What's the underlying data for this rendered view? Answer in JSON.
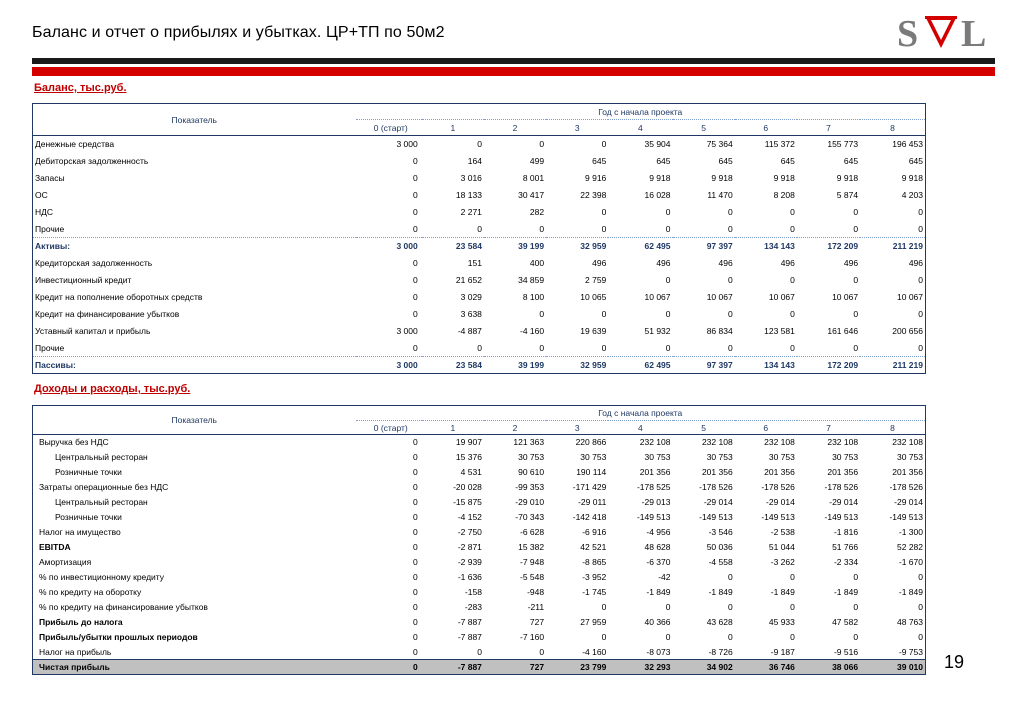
{
  "title": "Баланс и отчет о прибылях и убытках. ЦР+ТП по 50м2",
  "logo_text": "SVL",
  "colors": {
    "accent_red": "#d40000",
    "header_blue": "#1f3864",
    "total_gray": "#c0c0c0"
  },
  "balance": {
    "section_title": "Баланс, тыс.руб.",
    "indicator_header": "Показатель",
    "year_header": "Год с начала проекта",
    "columns": [
      "0 (старт)",
      "1",
      "2",
      "3",
      "4",
      "5",
      "6",
      "7",
      "8"
    ],
    "rows": [
      {
        "label": "Денежные средства",
        "values": [
          "3 000",
          "0",
          "0",
          "0",
          "35 904",
          "75 364",
          "115 372",
          "155 773",
          "196 453"
        ]
      },
      {
        "label": "Дебиторская задолженность",
        "values": [
          "0",
          "164",
          "499",
          "645",
          "645",
          "645",
          "645",
          "645",
          "645"
        ]
      },
      {
        "label": "Запасы",
        "values": [
          "0",
          "3 016",
          "8 001",
          "9 916",
          "9 918",
          "9 918",
          "9 918",
          "9 918",
          "9 918"
        ]
      },
      {
        "label": "ОС",
        "values": [
          "0",
          "18 133",
          "30 417",
          "22 398",
          "16 028",
          "11 470",
          "8 208",
          "5 874",
          "4 203"
        ]
      },
      {
        "label": "НДС",
        "values": [
          "0",
          "2 271",
          "282",
          "0",
          "0",
          "0",
          "0",
          "0",
          "0"
        ]
      },
      {
        "label": "Прочие",
        "values": [
          "0",
          "0",
          "0",
          "0",
          "0",
          "0",
          "0",
          "0",
          "0"
        ]
      },
      {
        "label": "Активы:",
        "values": [
          "3 000",
          "23 584",
          "39 199",
          "32 959",
          "62 495",
          "97 397",
          "134 143",
          "172 209",
          "211 219"
        ]
      },
      {
        "label": "Кредиторская задолженность",
        "values": [
          "0",
          "151",
          "400",
          "496",
          "496",
          "496",
          "496",
          "496",
          "496"
        ]
      },
      {
        "label": "Инвестиционный кредит",
        "values": [
          "0",
          "21 652",
          "34 859",
          "2 759",
          "0",
          "0",
          "0",
          "0",
          "0"
        ]
      },
      {
        "label": "Кредит на пополнение оборотных средств",
        "values": [
          "0",
          "3 029",
          "8 100",
          "10 065",
          "10 067",
          "10 067",
          "10 067",
          "10 067",
          "10 067"
        ]
      },
      {
        "label": "Кредит на финансирование убытков",
        "values": [
          "0",
          "3 638",
          "0",
          "0",
          "0",
          "0",
          "0",
          "0",
          "0"
        ]
      },
      {
        "label": "Уставный капитал и прибыль",
        "values": [
          "3 000",
          "-4 887",
          "-4 160",
          "19 639",
          "51 932",
          "86 834",
          "123 581",
          "161 646",
          "200 656"
        ]
      },
      {
        "label": "Прочие",
        "values": [
          "0",
          "0",
          "0",
          "0",
          "0",
          "0",
          "0",
          "0",
          "0"
        ]
      },
      {
        "label": "Пассивы:",
        "values": [
          "3 000",
          "23 584",
          "39 199",
          "32 959",
          "62 495",
          "97 397",
          "134 143",
          "172 209",
          "211 219"
        ]
      }
    ]
  },
  "pnl": {
    "section_title": "Доходы и расходы, тыс.руб.",
    "indicator_header": "Показатель",
    "year_header": "Год с начала проекта",
    "columns": [
      "0 (старт)",
      "1",
      "2",
      "3",
      "4",
      "5",
      "6",
      "7",
      "8"
    ],
    "rows": [
      {
        "label": "Выручка без НДС",
        "values": [
          "0",
          "19 907",
          "121 363",
          "220 866",
          "232 108",
          "232 108",
          "232 108",
          "232 108",
          "232 108"
        ]
      },
      {
        "label": "Центральный ресторан",
        "values": [
          "0",
          "15 376",
          "30 753",
          "30 753",
          "30 753",
          "30 753",
          "30 753",
          "30 753",
          "30 753"
        ]
      },
      {
        "label": "Розничные точки",
        "values": [
          "0",
          "4 531",
          "90 610",
          "190 114",
          "201 356",
          "201 356",
          "201 356",
          "201 356",
          "201 356"
        ]
      },
      {
        "label": "Затраты операционные без НДС",
        "values": [
          "0",
          "-20 028",
          "-99 353",
          "-171 429",
          "-178 525",
          "-178 526",
          "-178 526",
          "-178 526",
          "-178 526"
        ]
      },
      {
        "label": "Центральный ресторан",
        "values": [
          "0",
          "-15 875",
          "-29 010",
          "-29 011",
          "-29 013",
          "-29 014",
          "-29 014",
          "-29 014",
          "-29 014"
        ]
      },
      {
        "label": "Розничные точки",
        "values": [
          "0",
          "-4 152",
          "-70 343",
          "-142 418",
          "-149 513",
          "-149 513",
          "-149 513",
          "-149 513",
          "-149 513"
        ]
      },
      {
        "label": "Налог на имущество",
        "values": [
          "0",
          "-2 750",
          "-6 628",
          "-6 916",
          "-4 956",
          "-3 546",
          "-2 538",
          "-1 816",
          "-1 300"
        ]
      },
      {
        "label": "EBITDA",
        "values": [
          "0",
          "-2 871",
          "15 382",
          "42 521",
          "48 628",
          "50 036",
          "51 044",
          "51 766",
          "52 282"
        ]
      },
      {
        "label": "Амортизация",
        "values": [
          "0",
          "-2 939",
          "-7 948",
          "-8 865",
          "-6 370",
          "-4 558",
          "-3 262",
          "-2 334",
          "-1 670"
        ]
      },
      {
        "label": "% по инвестиционному кредиту",
        "values": [
          "0",
          "-1 636",
          "-5 548",
          "-3 952",
          "-42",
          "0",
          "0",
          "0",
          "0"
        ]
      },
      {
        "label": "% по кредиту на оборотку",
        "values": [
          "0",
          "-158",
          "-948",
          "-1 745",
          "-1 849",
          "-1 849",
          "-1 849",
          "-1 849",
          "-1 849"
        ]
      },
      {
        "label": "% по кредиту на финансирование убытков",
        "values": [
          "0",
          "-283",
          "-211",
          "0",
          "0",
          "0",
          "0",
          "0",
          "0"
        ]
      },
      {
        "label": "Прибыль до налога",
        "values": [
          "0",
          "-7 887",
          "727",
          "27 959",
          "40 366",
          "43 628",
          "45 933",
          "47 582",
          "48 763"
        ]
      },
      {
        "label": "Прибыль/убытки прошлых периодов",
        "values": [
          "0",
          "-7 887",
          "-7 160",
          "0",
          "0",
          "0",
          "0",
          "0",
          "0"
        ]
      },
      {
        "label": "Налог на прибыль",
        "values": [
          "0",
          "0",
          "0",
          "-4 160",
          "-8 073",
          "-8 726",
          "-9 187",
          "-9 516",
          "-9 753"
        ]
      },
      {
        "label": "Чистая прибыль",
        "values": [
          "0",
          "-7 887",
          "727",
          "23 799",
          "32 293",
          "34 902",
          "36 746",
          "38 066",
          "39 010"
        ]
      }
    ]
  },
  "page_number": "19"
}
